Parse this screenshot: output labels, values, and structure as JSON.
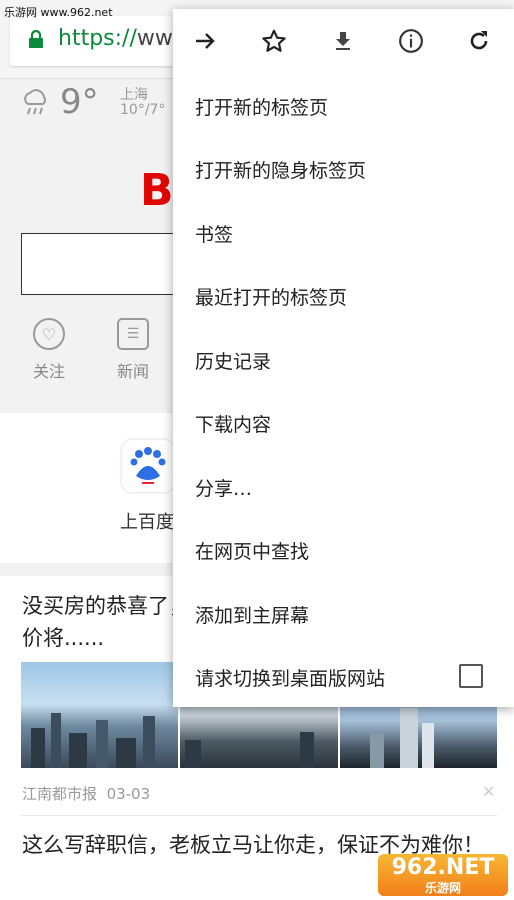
{
  "watermark_top": "乐游网 www.962.net",
  "url": {
    "scheme": "https://",
    "rest": "www"
  },
  "weather": {
    "temp": "9°",
    "city": "上海",
    "range": "10°/7°"
  },
  "logo_text": "B",
  "quick_links": [
    {
      "label": "关注",
      "icon": "heart-icon"
    },
    {
      "label": "新闻",
      "icon": "news-icon"
    }
  ],
  "app": {
    "label": "上百度",
    "icon_text": "du"
  },
  "feed": {
    "title1": "没买房的恭喜了，房价将......",
    "source": "江南都市报",
    "date": "03-03",
    "title2": "这么写辞职信，老板立马让你走，保证不为难你！"
  },
  "menu": {
    "toolbar": [
      "forward-icon",
      "star-icon",
      "download-icon",
      "info-icon",
      "refresh-icon"
    ],
    "items": [
      "打开新的标签页",
      "打开新的隐身标签页",
      "书签",
      "最近打开的标签页",
      "历史记录",
      "下载内容",
      "分享…",
      "在网页中查找",
      "添加到主屏幕",
      "请求切换到桌面版网站"
    ]
  },
  "watermark_logo": {
    "main": "962.NET",
    "sub": "乐游网"
  }
}
